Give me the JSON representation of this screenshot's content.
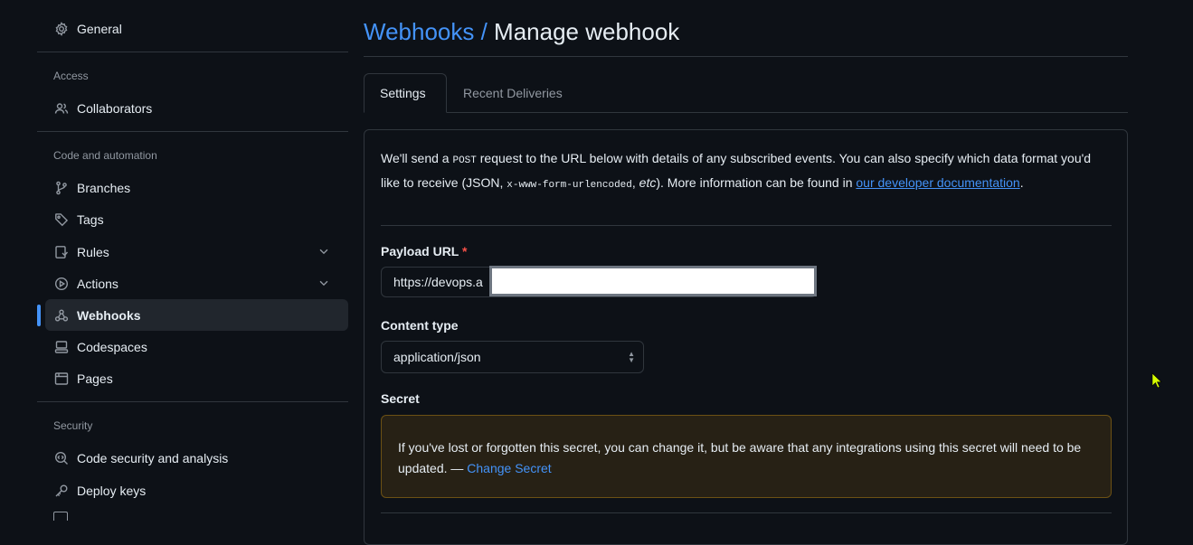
{
  "sidebar": {
    "general": "General",
    "access_title": "Access",
    "collaborators": "Collaborators",
    "code_title": "Code and automation",
    "branches": "Branches",
    "tags": "Tags",
    "rules": "Rules",
    "actions": "Actions",
    "webhooks": "Webhooks",
    "codespaces": "Codespaces",
    "pages": "Pages",
    "security_title": "Security",
    "code_security": "Code security and analysis",
    "deploy_keys": "Deploy keys"
  },
  "header": {
    "breadcrumb": "Webhooks",
    "separator": " / ",
    "title": "Manage webhook"
  },
  "tabs": {
    "settings": "Settings",
    "recent_deliveries": "Recent Deliveries"
  },
  "intro": {
    "p1": "We'll send a ",
    "post": "POST",
    "p2": " request to the URL below with details of any subscribed events. You can also specify which data format you'd like to receive (JSON, ",
    "urlencoded": "x-www-form-urlencoded",
    "p3": ", ",
    "etc": "etc",
    "p4": "). More information can be found in ",
    "link": "our developer documentation",
    "p5": "."
  },
  "payload": {
    "label": "Payload URL",
    "required_mark": "*",
    "value": "https://devops.a"
  },
  "content_type": {
    "label": "Content type",
    "value": "application/json"
  },
  "secret": {
    "label": "Secret",
    "notice": "If you've lost or forgotten this secret, you can change it, but be aware that any integrations using this secret will need to be updated. — ",
    "link": "Change Secret"
  },
  "colors": {
    "accent": "#4493f8",
    "background": "#0d1117",
    "warning_bg": "#272115"
  }
}
